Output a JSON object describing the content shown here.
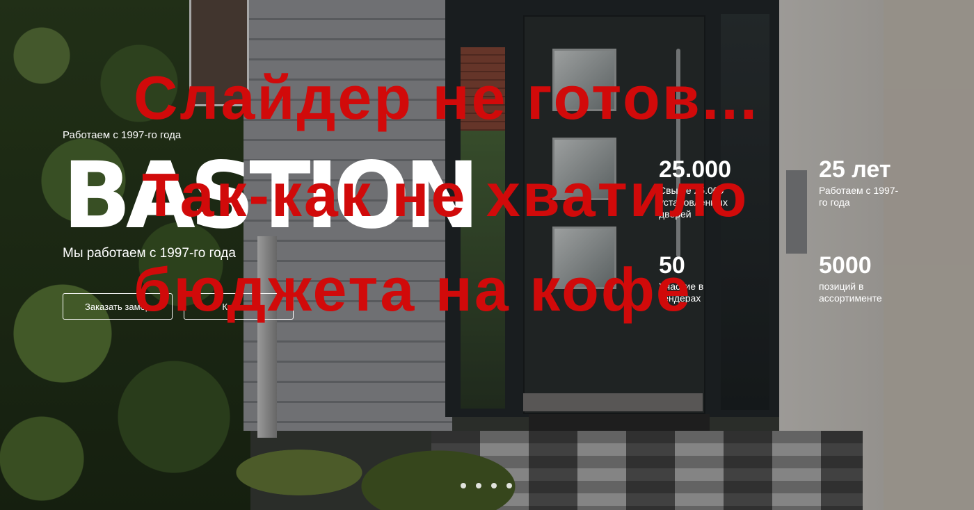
{
  "hero": {
    "since_label": "Работаем с 1997-го года",
    "logo_text": "BASTION",
    "subtitle": "Мы работаем с 1997-го года",
    "buttons": {
      "measure": "Заказать замер",
      "catalog": "Каталог"
    }
  },
  "stats": [
    {
      "number": "25.000",
      "description": "Свыше 25.000 установленных дверей"
    },
    {
      "number": "25 лет",
      "description": "Работаем с 1997-го года"
    },
    {
      "number": "50",
      "description": "Участие в тендерах"
    },
    {
      "number": "5000",
      "description": "позиций в ассортименте"
    }
  ],
  "notice": {
    "line1": "Слайдер не готов...",
    "line2": "Так-как не хватило",
    "line3": "бюджета на кофе",
    "color": "#d10a0a"
  },
  "slider": {
    "dot_count": 4
  }
}
